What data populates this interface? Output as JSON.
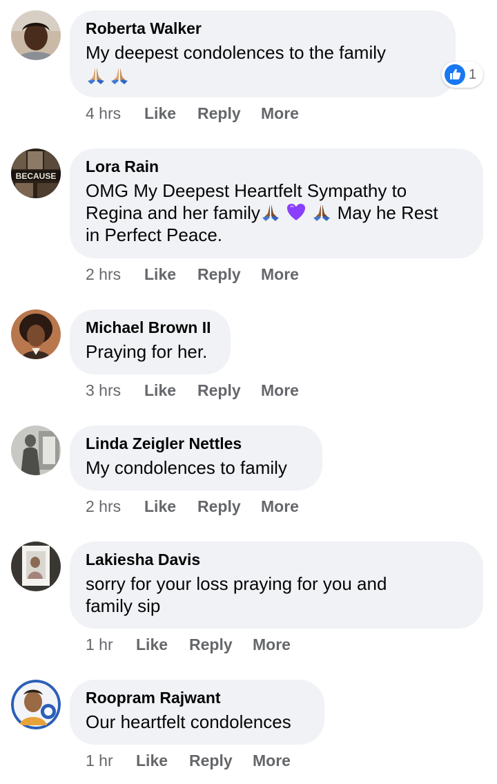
{
  "actions": {
    "like": "Like",
    "reply": "Reply",
    "more": "More"
  },
  "colors": {
    "bubble": "#f0f2f5",
    "meta_text": "#65676b",
    "like_blue": "#1877f2",
    "heart_purple": "#8a3ffc"
  },
  "comments": [
    {
      "author": "Roberta Walker",
      "text": "My deepest condolences to the family",
      "emoji_line": [
        "pray-light",
        "pray-light"
      ],
      "time": "4 hrs",
      "reactions": {
        "icon": "like-icon",
        "count": "1"
      }
    },
    {
      "author": "Lora Rain",
      "text_line1": "OMG My Deepest Heartfelt Sympathy to",
      "text_line2_a": "Regina and her family",
      "text_line2_b": "May he Rest",
      "text_line3": "in Perfect Peace.",
      "emojis": [
        "pray-dark",
        "purple-heart",
        "pray-dark"
      ],
      "time": "2 hrs"
    },
    {
      "author": "Michael Brown II",
      "text": "Praying for her.",
      "time": "3 hrs"
    },
    {
      "author": "Linda Zeigler Nettles",
      "text": "My condolences to family",
      "time": "2 hrs"
    },
    {
      "author": "Lakiesha Davis",
      "text_line1": "sorry for your loss praying for you and",
      "text_line2": "family sip",
      "time": "1 hr"
    },
    {
      "author": "Roopram Rajwant",
      "text": "Our heartfelt condolences",
      "time": "1 hr"
    }
  ]
}
